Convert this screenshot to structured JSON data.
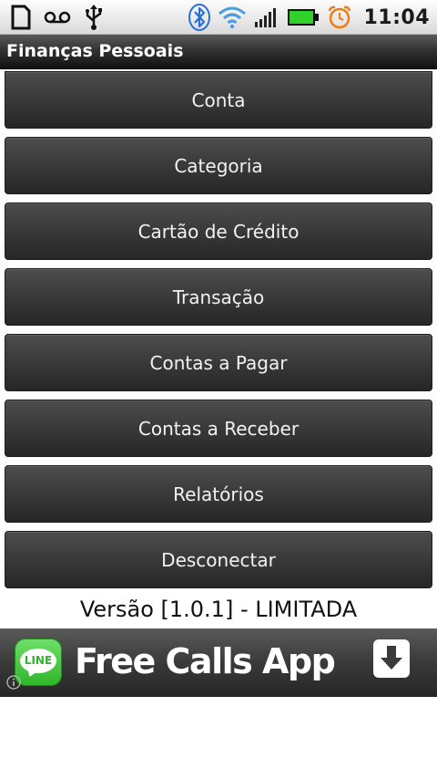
{
  "status_bar": {
    "time": "11:04",
    "left_icons": [
      "sd-card-icon",
      "voicemail-icon",
      "usb-icon"
    ],
    "right_icons": [
      "bluetooth-icon",
      "wifi-icon",
      "signal-icon",
      "battery-icon",
      "alarm-clock-icon"
    ],
    "battery_color": "#2fd12a",
    "alarm_color": "#f07d1a",
    "bluetooth_color": "#2a6fd6",
    "wifi_color": "#4a9be0"
  },
  "title_bar": {
    "title": "Finanças Pessoais"
  },
  "menu": {
    "items": [
      {
        "label": "Conta"
      },
      {
        "label": "Categoria"
      },
      {
        "label": "Cartão de Crédito"
      },
      {
        "label": "Transação"
      },
      {
        "label": "Contas a Pagar"
      },
      {
        "label": "Contas a Receber"
      },
      {
        "label": "Relatórios"
      },
      {
        "label": "Desconectar"
      }
    ]
  },
  "version": "Versão [1.0.1] - LIMITADA",
  "ad": {
    "logo_text": "LINE",
    "text": "Free Calls App",
    "icons": [
      "line-logo-icon",
      "download-icon",
      "info-icon"
    ]
  }
}
